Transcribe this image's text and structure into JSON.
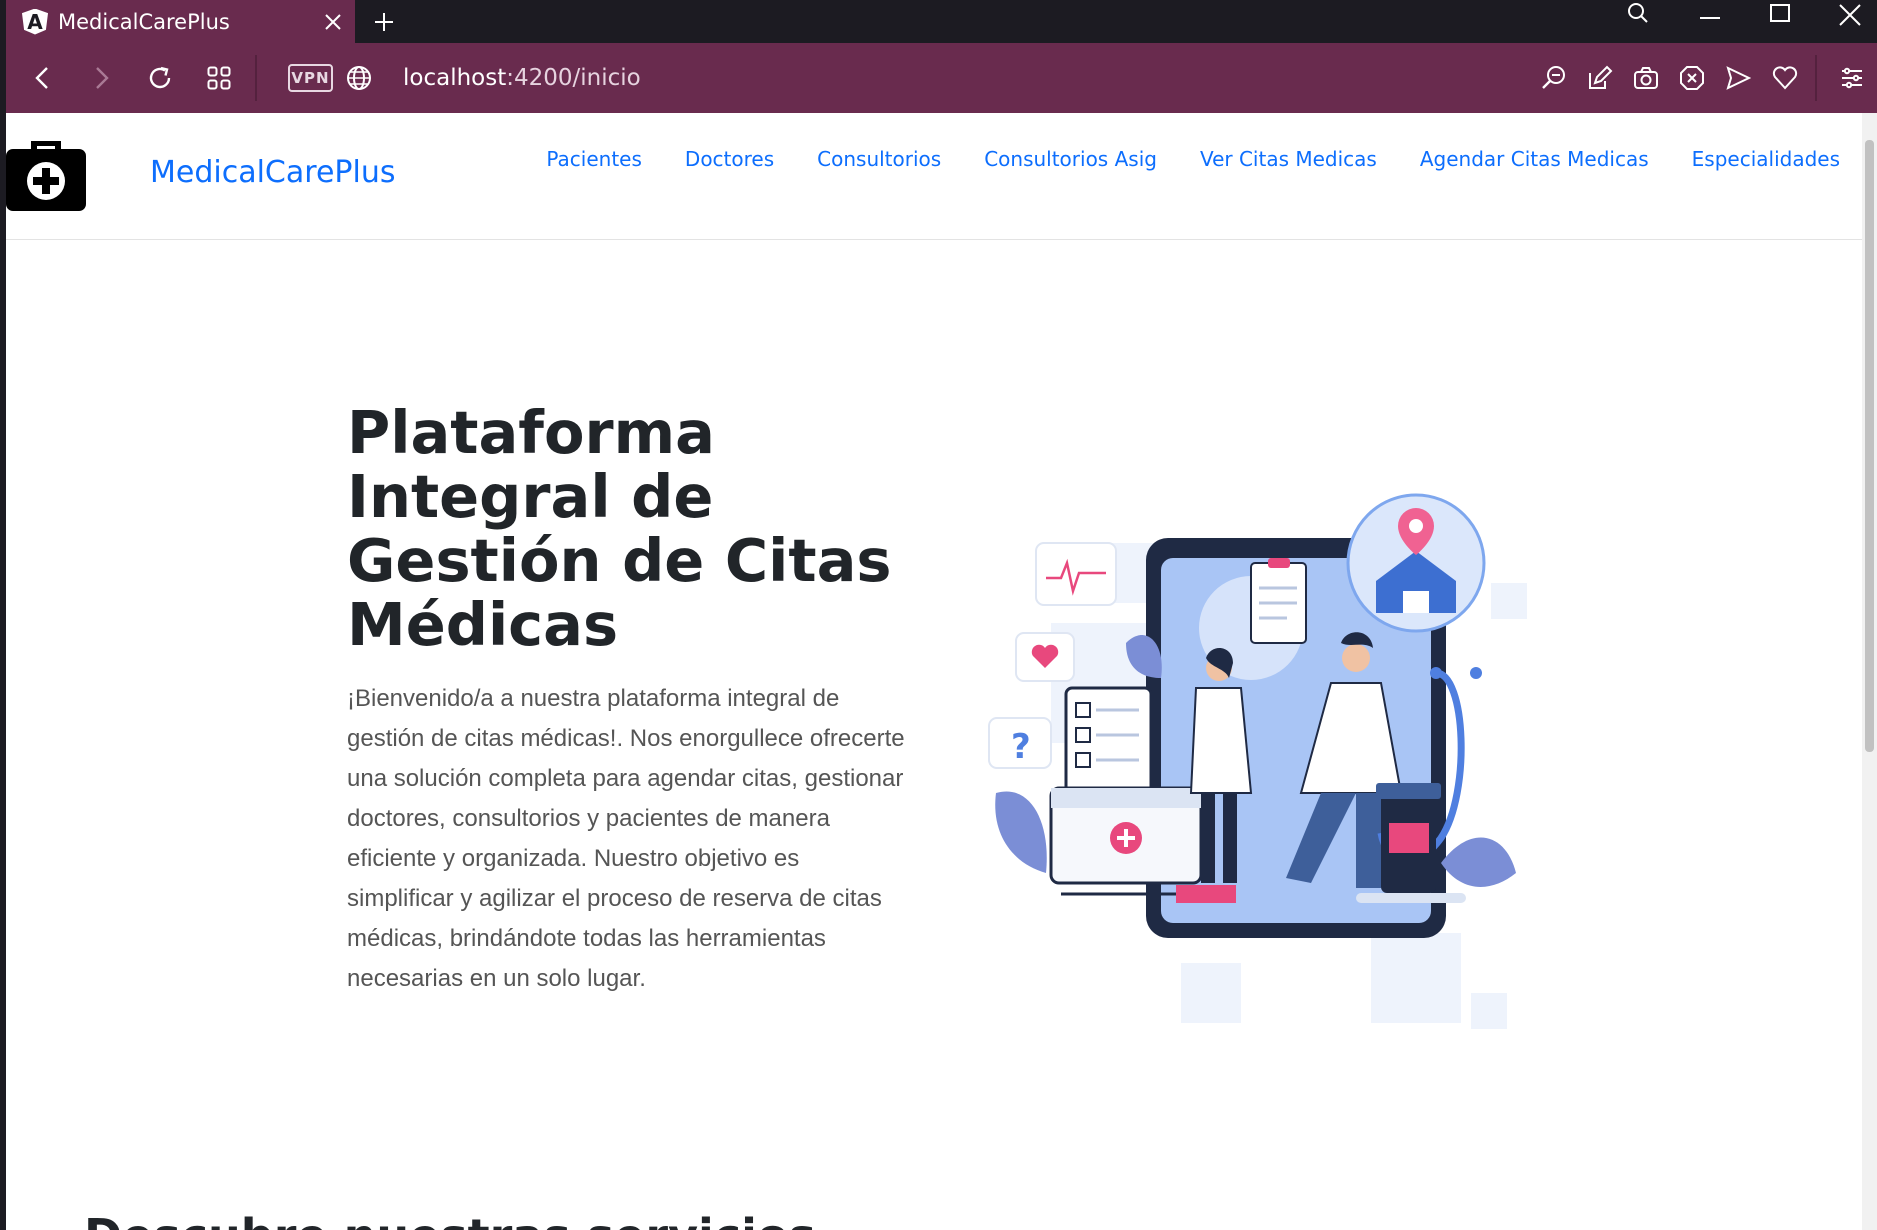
{
  "browser": {
    "tab_title": "MedicalCarePlus",
    "tab_favicon": "A",
    "vpn_label": "VPN",
    "url_host": "localhost",
    "url_path": ":4200/inicio"
  },
  "navbar": {
    "brand": "MedicalCarePlus",
    "links": [
      "Pacientes",
      "Doctores",
      "Consultorios",
      "Consultorios Asig",
      "Ver Citas Medicas",
      "Agendar Citas Medicas",
      "Especialidades"
    ]
  },
  "hero": {
    "title": "Plataforma Integral de Gestión de Citas Médicas",
    "description": "¡Bienvenido/a a nuestra plataforma integral de gestión de citas médicas!. Nos enorgullece ofrecerte una solución completa para agendar citas, gestionar doctores, consultorios y pacientes de manera eficiente y organizada. Nuestro objetivo es simplificar y agilizar el proceso de reserva de citas médicas, brindándote todas las herramientas necesarias en un solo lugar."
  },
  "section": {
    "partial_heading": "Descubre nuestras servicios"
  },
  "colors": {
    "browser_accent": "#692b4e",
    "tabbar_bg": "#1c1b22",
    "link_blue": "#0d6efd",
    "text_dark": "#212529"
  }
}
